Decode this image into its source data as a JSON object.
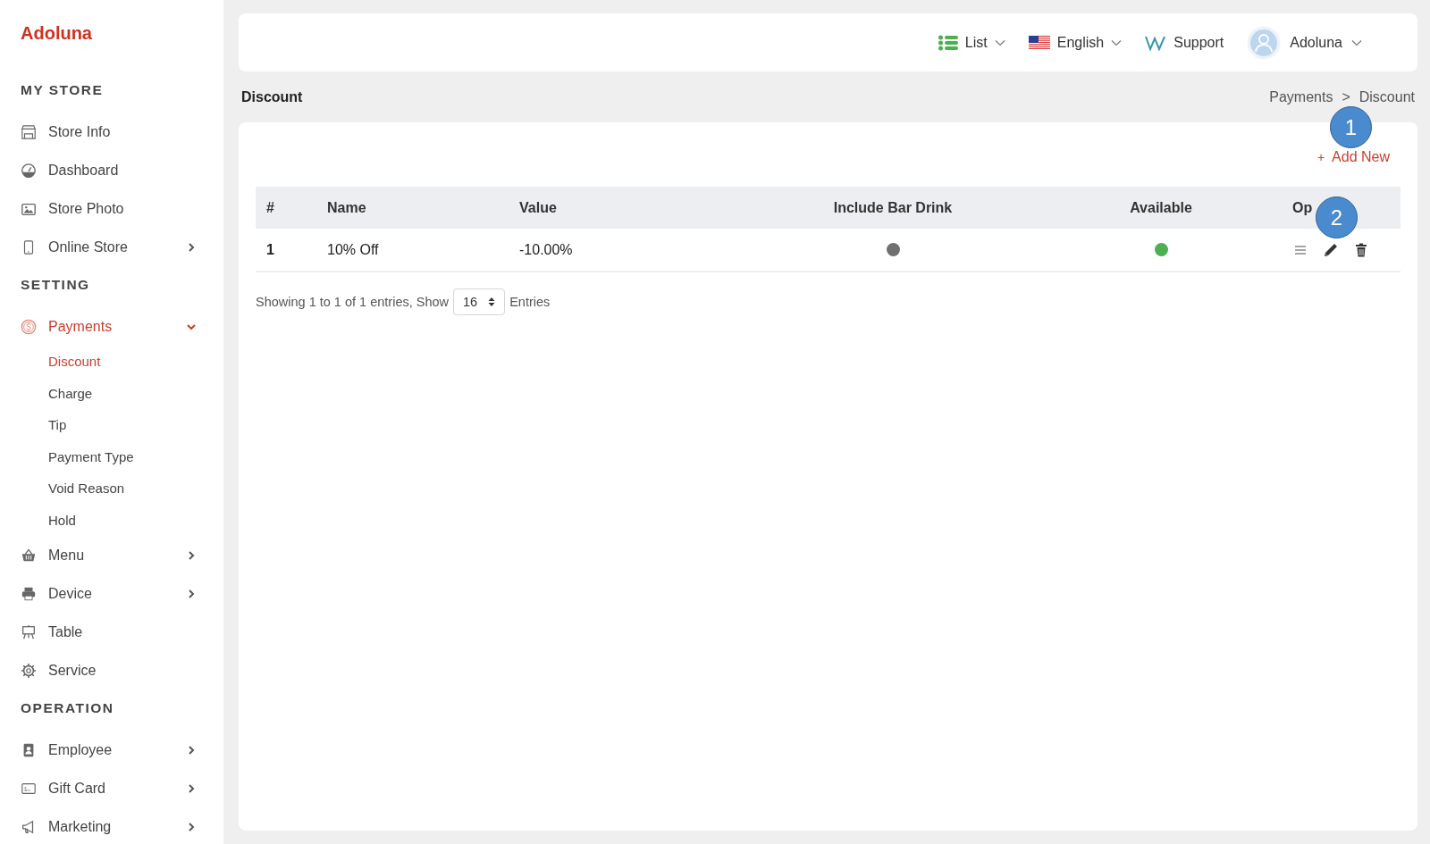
{
  "sidebar": {
    "logo": "Adoluna",
    "sections": [
      {
        "title": "MY STORE",
        "items": [
          {
            "label": "Store Info",
            "selected": false
          },
          {
            "label": "Dashboard",
            "selected": false
          },
          {
            "label": "Store Photo",
            "selected": false
          },
          {
            "label": "Online Store",
            "expanded": false,
            "selected": false
          }
        ]
      },
      {
        "title": "SETTING",
        "items": [
          {
            "label": "Payments",
            "expanded": true,
            "selected": true,
            "children": [
              {
                "label": "Discount",
                "selected": true
              },
              {
                "label": "Charge",
                "selected": false
              },
              {
                "label": "Tip",
                "selected": false
              },
              {
                "label": "Payment Type",
                "selected": false
              },
              {
                "label": "Void Reason",
                "selected": false
              },
              {
                "label": "Hold",
                "selected": false
              }
            ]
          },
          {
            "label": "Menu",
            "expanded": false,
            "selected": false
          },
          {
            "label": "Device",
            "expanded": false,
            "selected": false
          },
          {
            "label": "Table",
            "selected": false
          },
          {
            "label": "Service",
            "selected": false
          }
        ]
      },
      {
        "title": "OPERATION",
        "items": [
          {
            "label": "Employee",
            "expanded": false,
            "selected": false
          },
          {
            "label": "Gift Card",
            "expanded": false,
            "selected": false
          },
          {
            "label": "Marketing",
            "expanded": false,
            "selected": false
          }
        ]
      }
    ]
  },
  "topbar": {
    "view": "List",
    "language": "English",
    "support": "Support",
    "user": "Adoluna"
  },
  "page": {
    "title": "Discount",
    "breadcrumb": [
      "Payments",
      ">",
      "Discount"
    ]
  },
  "add_button": {
    "icon_text": "+",
    "label": "Add New"
  },
  "table": {
    "columns": [
      "#",
      "Name",
      "Value",
      "Include Bar Drink",
      "Available",
      "Op"
    ],
    "rows": [
      {
        "index": "1",
        "name": "10% Off",
        "value": "-10.00%",
        "include_bar_drink": false,
        "available": true
      }
    ]
  },
  "footer": {
    "summary": "Showing 1 to 1 of 1 entries, Show",
    "page_size": "16",
    "suffix": "Entries"
  },
  "callouts": [
    "1",
    "2"
  ]
}
